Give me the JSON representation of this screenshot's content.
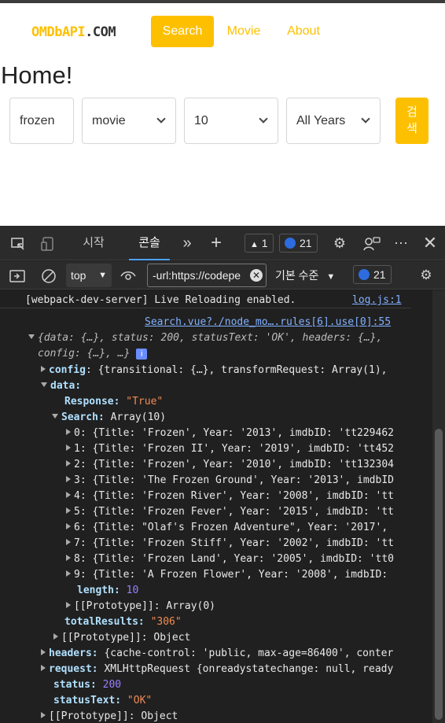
{
  "app": {
    "logo_brand": "OMDbAPI",
    "logo_tld": ".COM",
    "nav": [
      "Search",
      "Movie",
      "About"
    ],
    "title": "Home!",
    "search": {
      "query": "frozen",
      "type": "movie",
      "count": "10",
      "year": "All Years",
      "button_label_line1": "검",
      "button_label_line2": "색"
    }
  },
  "devtools": {
    "tabs": [
      "시작",
      "콘솔"
    ],
    "warn_count": "1",
    "msg_count": "21",
    "context": "top",
    "filter_value": "-url:https://codepe",
    "level": "기본 수준",
    "toolbar_count": "21",
    "colors": {
      "accent": "#fdc000",
      "blue": "#4ea1ff"
    }
  },
  "console": {
    "info_message": "[webpack-dev-server] Live Reloading enabled.",
    "info_source": "log.js:1",
    "log_source": "Search.vue?./node_mo….rules[6].use[0]:55",
    "summary_line1": "{data: {…}, status: 200, statusText: 'OK', headers: {…},",
    "summary_line2": "config: {…}, …}",
    "config_line": "{transitional: {…}, transformRequest: Array(1),",
    "data_key": "data:",
    "response_key": "Response:",
    "response_val": "\"True\"",
    "search_key": "Search:",
    "search_val": "Array(10)",
    "items": [
      "0: {Title: 'Frozen', Year: '2013', imdbID: 'tt229462",
      "1: {Title: 'Frozen II', Year: '2019', imdbID: 'tt452",
      "2: {Title: 'Frozen', Year: '2010', imdbID: 'tt132304",
      "3: {Title: 'The Frozen Ground', Year: '2013', imdbID",
      "4: {Title: 'Frozen River', Year: '2008', imdbID: 'tt",
      "5: {Title: 'Frozen Fever', Year: '2015', imdbID: 'tt",
      "6: {Title: \"Olaf's Frozen Adventure\", Year: '2017',",
      "7: {Title: 'Frozen Stiff', Year: '2002', imdbID: 'tt",
      "8: {Title: 'Frozen Land', Year: '2005', imdbID: 'tt0",
      "9: {Title: 'A Frozen Flower', Year: '2008', imdbID:"
    ],
    "length_key": "length:",
    "length_val": "10",
    "proto_array": "[[Prototype]]: Array(0)",
    "total_key": "totalResults:",
    "total_val": "\"306\"",
    "proto_obj": "[[Prototype]]: Object",
    "headers_key": "headers:",
    "headers_val": "{cache-control: 'public, max-age=86400', conter",
    "request_key": "request:",
    "request_val": "XMLHttpRequest {onreadystatechange: null, ready",
    "status_key": "status:",
    "status_val": "200",
    "statustext_key": "statusText:",
    "statustext_val": "\"OK\"",
    "proto_outer": "[[Prototype]]: Object"
  }
}
